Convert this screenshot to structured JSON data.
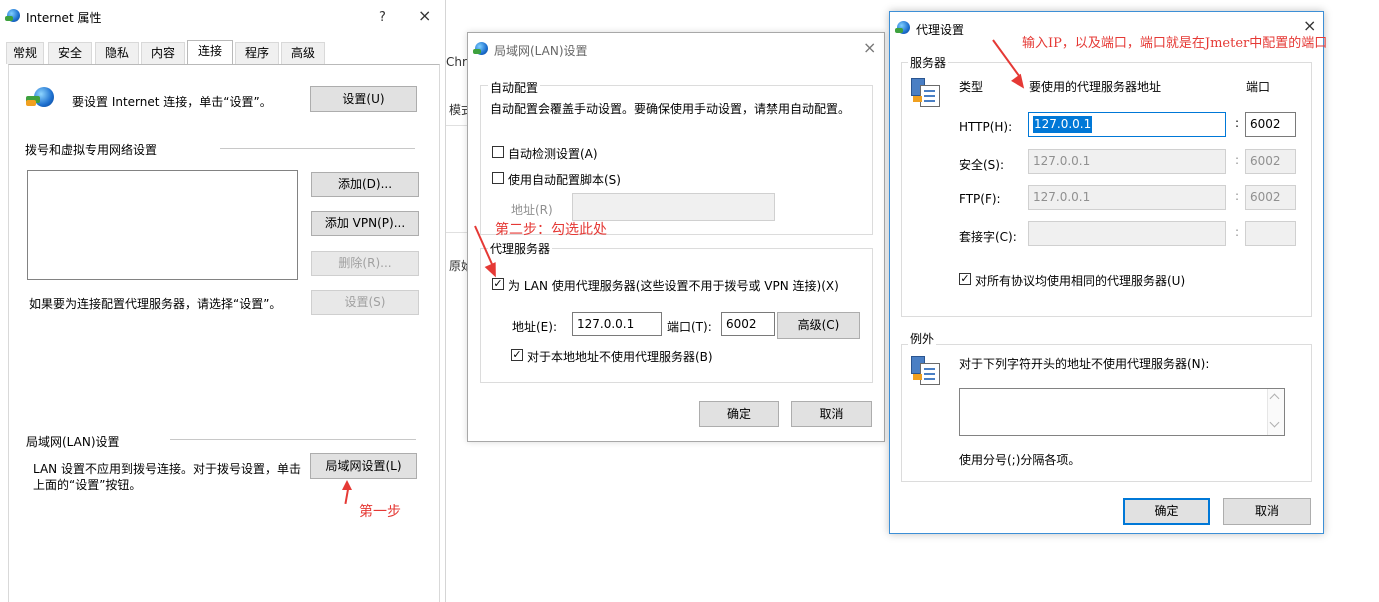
{
  "internet_props": {
    "title": "Internet 属性",
    "help": "?",
    "close": "×",
    "tabs": [
      "常规",
      "安全",
      "隐私",
      "内容",
      "连接",
      "程序",
      "高级"
    ],
    "setup_text": "要设置 Internet 连接，单击“设置”。",
    "setup_button": "设置(U)",
    "dialup_heading": "拨号和虚拟专用网络设置",
    "add_button": "添加(D)...",
    "add_vpn_button": "添加 VPN(P)...",
    "delete_button": "删除(R)...",
    "settings_button": "设置(S)",
    "proxy_hint": "如果要为连接配置代理服务器，请选择“设置”。",
    "lan_heading": "局域网(LAN)设置",
    "lan_text_1": "LAN 设置不应用到拨号连接。对于拨号设置，单击",
    "lan_text_2": "上面的“设置”按钮。",
    "lan_button": "局域网设置(L)"
  },
  "background_fragments": [
    "Chro",
    "模式",
    "原始"
  ],
  "lan_dialog": {
    "title": "局域网(LAN)设置",
    "close": "×",
    "auto_heading": "自动配置",
    "auto_desc": "自动配置会覆盖手动设置。要确保使用手动设置，请禁用自动配置。",
    "auto_detect": "自动检测设置(A)",
    "auto_script": "使用自动配置脚本(S)",
    "address_label": "地址(R)",
    "proxy_heading": "代理服务器",
    "use_proxy": "为 LAN 使用代理服务器(这些设置不用于拨号或 VPN 连接)(X)",
    "addr_label": "地址(E):",
    "addr_value": "127.0.0.1",
    "port_label": "端口(T):",
    "port_value": "6002",
    "advanced_button": "高级(C)",
    "bypass_local": "对于本地地址不使用代理服务器(B)",
    "ok_button": "确定",
    "cancel_button": "取消"
  },
  "proxy_dialog": {
    "title": "代理设置",
    "close": "×",
    "servers_heading": "服务器",
    "type_col": "类型",
    "address_col": "要使用的代理服务器地址",
    "port_col": "端口",
    "rows": [
      {
        "label": "HTTP(H):",
        "addr": "127.0.0.1",
        "port": "6002"
      },
      {
        "label": "安全(S):",
        "addr": "127.0.0.1",
        "port": "6002"
      },
      {
        "label": "FTP(F):",
        "addr": "127.0.0.1",
        "port": "6002"
      },
      {
        "label": "套接字(C):",
        "addr": "",
        "port": ""
      }
    ],
    "colon": ":",
    "same_proxy": "对所有协议均使用相同的代理服务器(U)",
    "exceptions_heading": "例外",
    "exceptions_desc": "对于下列字符开头的地址不使用代理服务器(N):",
    "exceptions_hint": "使用分号(;)分隔各项。",
    "ok_button": "确定",
    "cancel_button": "取消"
  },
  "annotations": {
    "step1": "第一步",
    "step2": "第二步：勾选此处",
    "step3": "输入IP，以及端口，端口就是在Jmeter中配置的端口"
  },
  "colors": {
    "annotation": "#e53935",
    "focus": "#0078d7"
  }
}
